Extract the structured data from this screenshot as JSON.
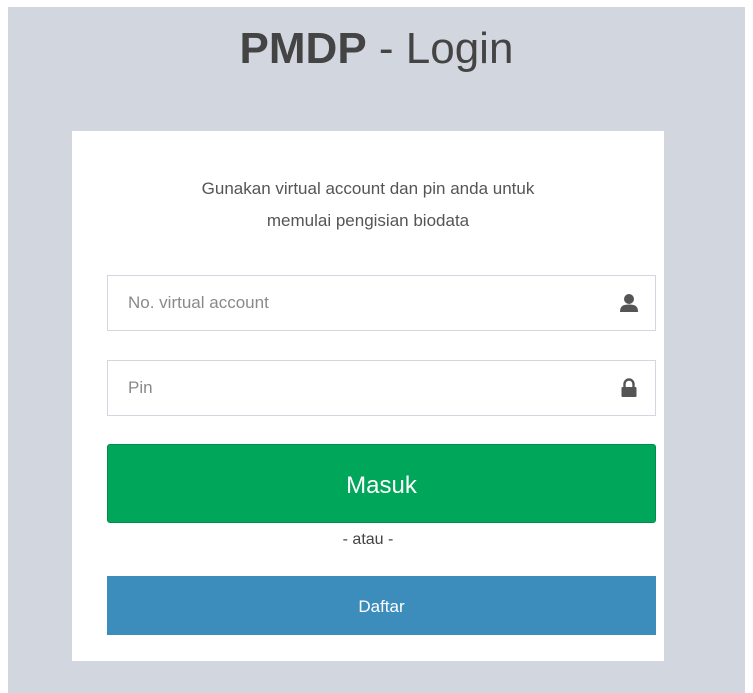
{
  "logo": {
    "brand": "PMDP",
    "rest": " - Login"
  },
  "login_box": {
    "message_line1": "Gunakan virtual account dan pin anda untuk",
    "message_line2": "memulai pengisian biodata",
    "virtual_account": {
      "value": "",
      "placeholder": "No. virtual account",
      "icon": "user-icon"
    },
    "pin": {
      "value": "",
      "placeholder": "Pin",
      "icon": "lock-icon"
    },
    "submit_label": "Masuk",
    "or_text": "- atau -",
    "register_label": "Daftar"
  },
  "colors": {
    "page_background": "#d2d6de",
    "submit_button": "#00a65a",
    "register_button": "#3c8dbc",
    "card": "#ffffff"
  }
}
